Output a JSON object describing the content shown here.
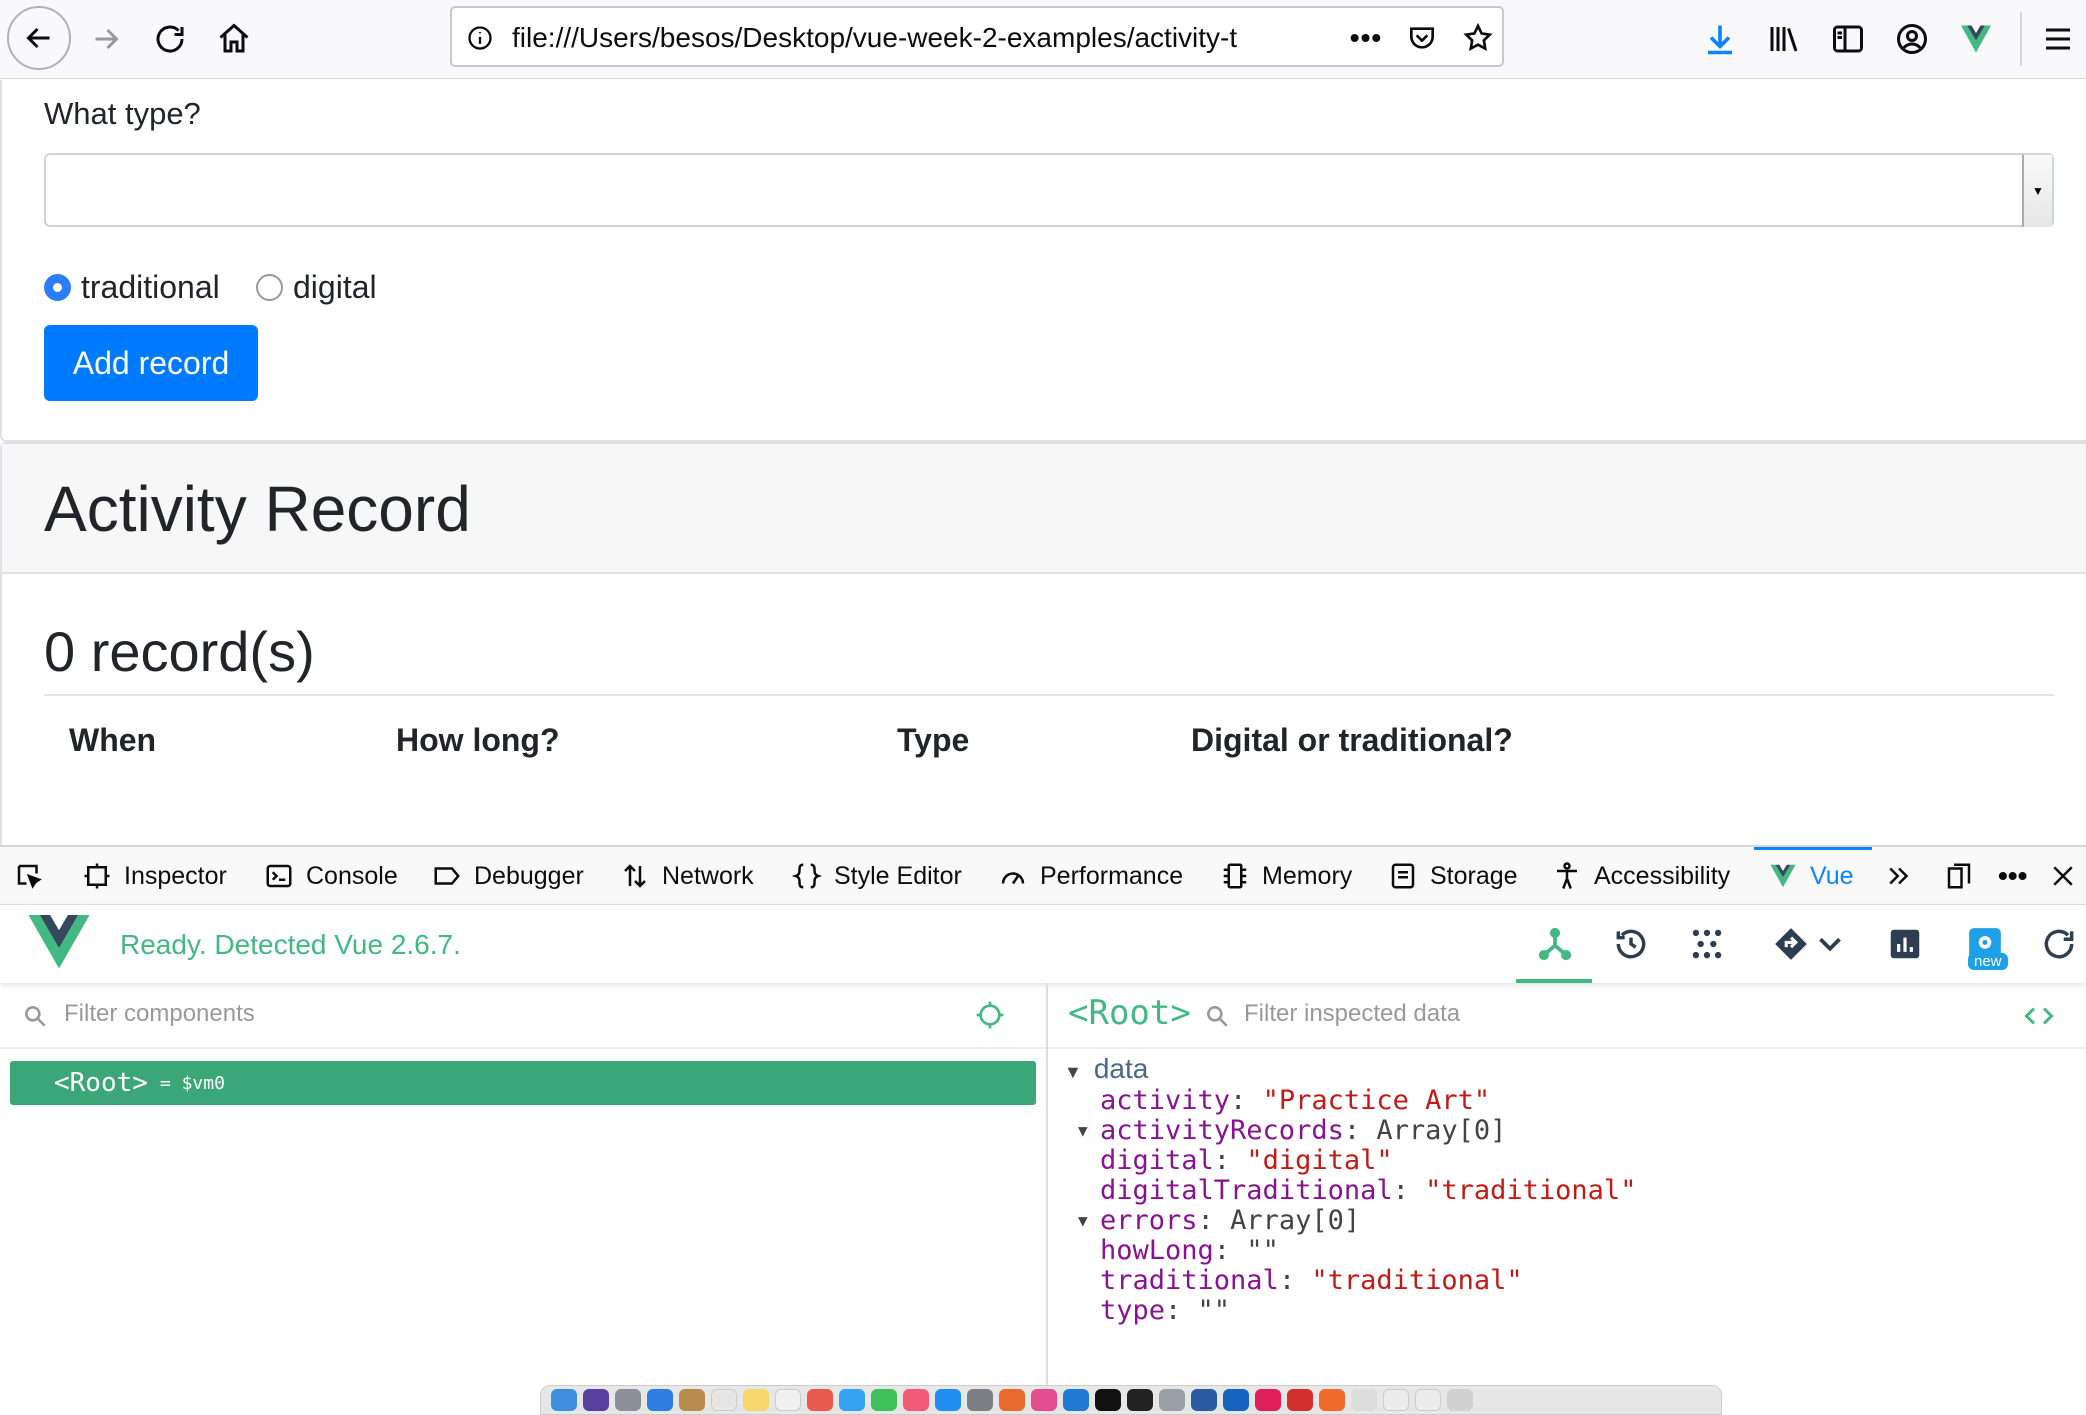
{
  "browser": {
    "url": "file:///Users/besos/Desktop/vue-week-2-examples/activity-t",
    "icons": [
      "back-arrow-icon",
      "forward-arrow-icon",
      "reload-icon",
      "home-icon",
      "info-icon",
      "more-dots-icon",
      "pocket-icon",
      "bookmark-star-icon",
      "download-icon",
      "library-icon",
      "sidebar-icon",
      "account-icon",
      "vue-extension-icon",
      "menu-icon"
    ]
  },
  "form": {
    "type_label": "What type?",
    "type_value": "",
    "radio_traditional": "traditional",
    "radio_digital": "digital",
    "selected_radio": "traditional",
    "add_button": "Add record"
  },
  "record": {
    "title": "Activity Record",
    "count": "0 record(s)",
    "columns": [
      "When",
      "How long?",
      "Type",
      "Digital or traditional?"
    ]
  },
  "devtools": {
    "tabs": [
      {
        "label": "Inspector",
        "icon": "inspector-icon"
      },
      {
        "label": "Console",
        "icon": "console-icon"
      },
      {
        "label": "Debugger",
        "icon": "debugger-icon"
      },
      {
        "label": "Network",
        "icon": "network-icon"
      },
      {
        "label": "Style Editor",
        "icon": "style-editor-icon"
      },
      {
        "label": "Performance",
        "icon": "performance-icon"
      },
      {
        "label": "Memory",
        "icon": "memory-icon"
      },
      {
        "label": "Storage",
        "icon": "storage-icon"
      },
      {
        "label": "Accessibility",
        "icon": "accessibility-icon"
      },
      {
        "label": "Vue",
        "icon": "vue-icon"
      }
    ],
    "active_tab": "Vue"
  },
  "vue": {
    "status": "Ready. Detected Vue 2.6.7.",
    "new_badge": "new",
    "accent": "#42b983",
    "filter_components_placeholder": "Filter components",
    "root_component": "<Root>",
    "root_suffix": "= $vm0",
    "inspected_component": "<Root>",
    "filter_data_placeholder": "Filter inspected data",
    "data_section": "data",
    "data": [
      {
        "key": "activity",
        "value": "\"Practice Art\"",
        "kind": "string"
      },
      {
        "key": "activityRecords",
        "value": "Array[0]",
        "kind": "array"
      },
      {
        "key": "digital",
        "value": "\"digital\"",
        "kind": "string"
      },
      {
        "key": "digitalTraditional",
        "value": "\"traditional\"",
        "kind": "string"
      },
      {
        "key": "errors",
        "value": "Array[0]",
        "kind": "array"
      },
      {
        "key": "howLong",
        "value": "\"\"",
        "kind": "plain"
      },
      {
        "key": "traditional",
        "value": "\"traditional\"",
        "kind": "string"
      },
      {
        "key": "type",
        "value": "\"\"",
        "kind": "plain"
      }
    ]
  }
}
